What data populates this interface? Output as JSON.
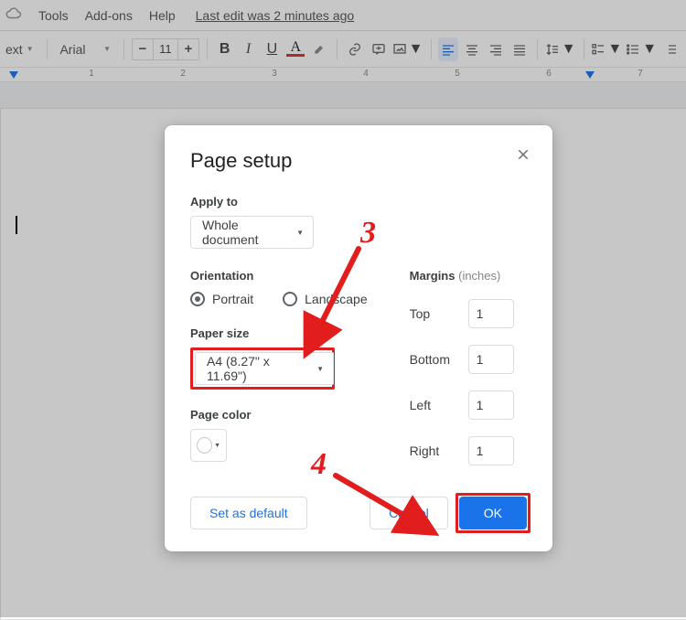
{
  "menubar": {
    "items": [
      "Tools",
      "Add-ons",
      "Help"
    ],
    "last_edit": "Last edit was 2 minutes ago"
  },
  "toolbar": {
    "style_label": "ext",
    "font_label": "Arial",
    "font_size": "11"
  },
  "dialog": {
    "title": "Page setup",
    "apply_to_label": "Apply to",
    "apply_to_value": "Whole document",
    "orientation_label": "Orientation",
    "orientation_portrait": "Portrait",
    "orientation_landscape": "Landscape",
    "paper_size_label": "Paper size",
    "paper_size_value": "A4 (8.27\" x 11.69\")",
    "page_color_label": "Page color",
    "margins_label": "Margins",
    "margins_unit": "(inches)",
    "margin_top_label": "Top",
    "margin_top_value": "1",
    "margin_bottom_label": "Bottom",
    "margin_bottom_value": "1",
    "margin_left_label": "Left",
    "margin_left_value": "1",
    "margin_right_label": "Right",
    "margin_right_value": "1",
    "set_default_label": "Set as default",
    "cancel_label": "Cancel",
    "ok_label": "OK"
  },
  "annotations": {
    "step3": "3",
    "step4": "4"
  }
}
